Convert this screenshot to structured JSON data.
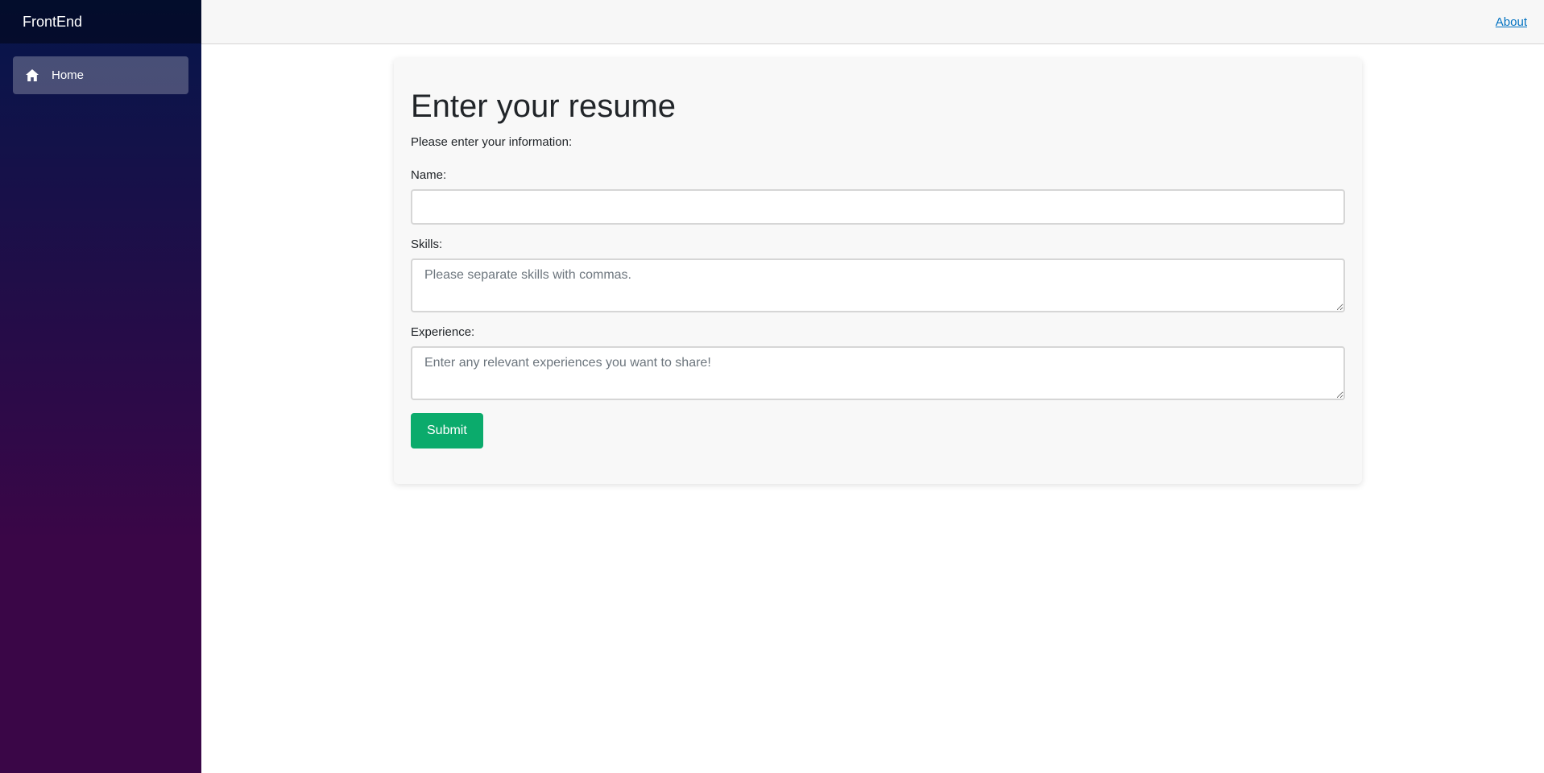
{
  "sidebar": {
    "brand": "FrontEnd",
    "items": [
      {
        "label": "Home",
        "icon": "home-icon",
        "active": true
      }
    ]
  },
  "header": {
    "about_link": "About"
  },
  "form": {
    "title": "Enter your resume",
    "intro": "Please enter your information:",
    "name_label": "Name:",
    "name_value": "",
    "skills_label": "Skills:",
    "skills_placeholder": "Please separate skills with commas.",
    "experience_label": "Experience:",
    "experience_placeholder": "Enter any relevant experiences you want to share!",
    "submit_label": "Submit"
  },
  "colors": {
    "accent_button": "#0bab6c",
    "link": "#0071c1",
    "sidebar_top": "#05164a",
    "sidebar_bottom": "#3a0647"
  }
}
